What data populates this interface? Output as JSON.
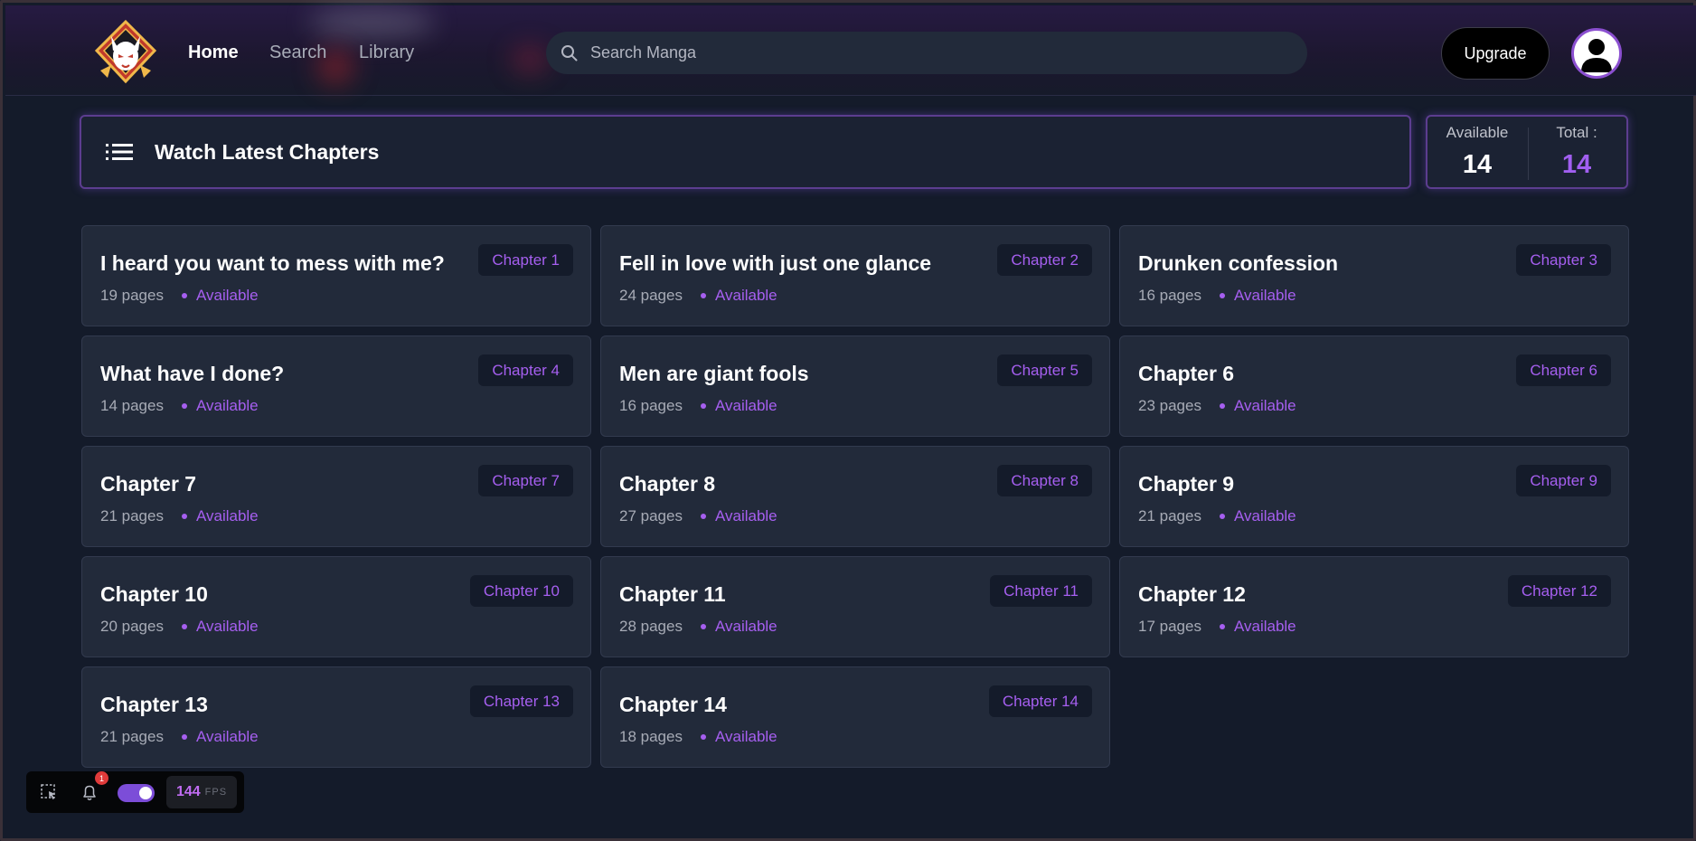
{
  "header": {
    "nav": [
      {
        "label": "Home",
        "active": true
      },
      {
        "label": "Search",
        "active": false
      },
      {
        "label": "Library",
        "active": false
      }
    ],
    "search_placeholder": "Search Manga",
    "upgrade_label": "Upgrade",
    "accent": "#a65ff0"
  },
  "section": {
    "title": "Watch Latest Chapters",
    "stats": {
      "available_label": "Available",
      "available_value": "14",
      "total_label": "Total :",
      "total_value": "14"
    }
  },
  "chapters": [
    {
      "title": "I heard you want to mess with me?",
      "badge": "Chapter 1",
      "pages": "19 pages",
      "status": "Available"
    },
    {
      "title": "Fell in love with just one glance",
      "badge": "Chapter 2",
      "pages": "24 pages",
      "status": "Available"
    },
    {
      "title": "Drunken confession",
      "badge": "Chapter 3",
      "pages": "16 pages",
      "status": "Available"
    },
    {
      "title": "What have I done?",
      "badge": "Chapter 4",
      "pages": "14 pages",
      "status": "Available"
    },
    {
      "title": "Men are giant fools",
      "badge": "Chapter 5",
      "pages": "16 pages",
      "status": "Available"
    },
    {
      "title": "Chapter 6",
      "badge": "Chapter 6",
      "pages": "23 pages",
      "status": "Available"
    },
    {
      "title": "Chapter 7",
      "badge": "Chapter 7",
      "pages": "21 pages",
      "status": "Available"
    },
    {
      "title": "Chapter 8",
      "badge": "Chapter 8",
      "pages": "27 pages",
      "status": "Available"
    },
    {
      "title": "Chapter 9",
      "badge": "Chapter 9",
      "pages": "21 pages",
      "status": "Available"
    },
    {
      "title": "Chapter 10",
      "badge": "Chapter 10",
      "pages": "20 pages",
      "status": "Available"
    },
    {
      "title": "Chapter 11",
      "badge": "Chapter 11",
      "pages": "28 pages",
      "status": "Available"
    },
    {
      "title": "Chapter 12",
      "badge": "Chapter 12",
      "pages": "17 pages",
      "status": "Available"
    },
    {
      "title": "Chapter 13",
      "badge": "Chapter 13",
      "pages": "21 pages",
      "status": "Available"
    },
    {
      "title": "Chapter 14",
      "badge": "Chapter 14",
      "pages": "18 pages",
      "status": "Available"
    }
  ],
  "toolbar": {
    "notification_count": "1",
    "fps_value": "144",
    "fps_label": "FPS",
    "icons": [
      "select-region-icon",
      "bell-icon",
      "toggle-switch"
    ]
  }
}
